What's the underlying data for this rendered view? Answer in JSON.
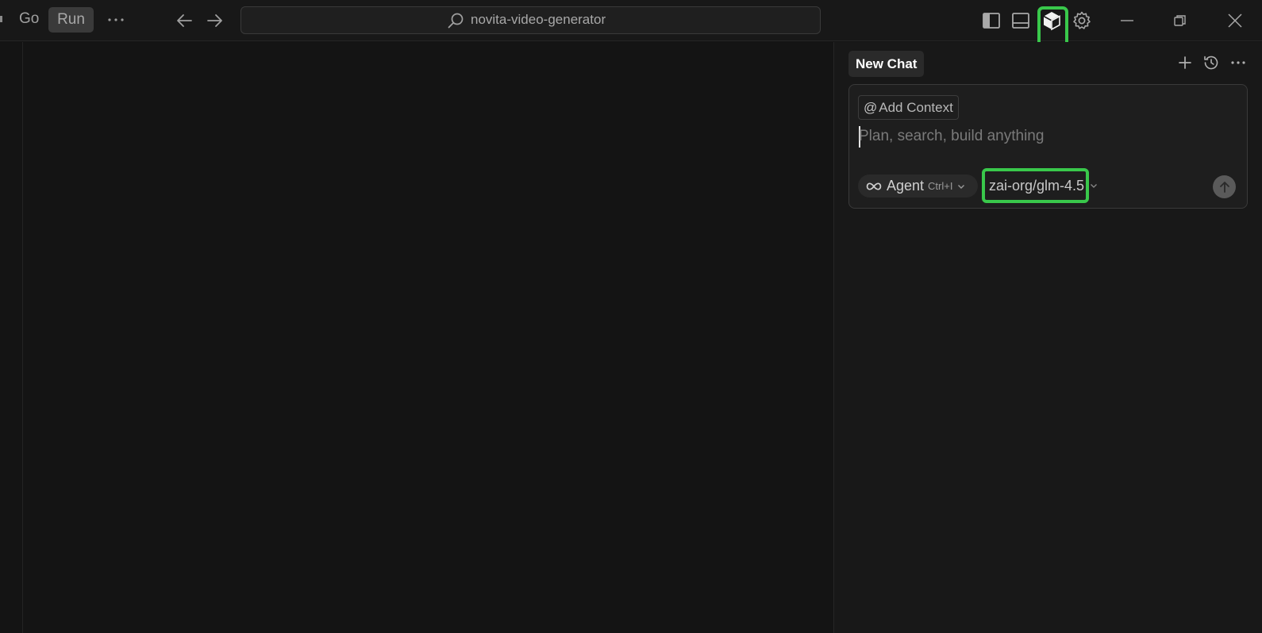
{
  "titlebar": {
    "menu_go": "Go",
    "menu_run": "Run",
    "search_text": "novita-video-generator"
  },
  "icons": {
    "menu_more": "ellipsis-icon",
    "back": "arrow-left-icon",
    "forward": "arrow-right-icon",
    "search": "search-icon",
    "toggle_sidebar": "sidebar-panel-icon",
    "toggle_bottom_panel": "bottom-panel-icon",
    "ai_chat": "cube-icon",
    "settings": "gear-icon",
    "minimize": "minimize-icon",
    "restore": "restore-icon",
    "close": "close-icon"
  },
  "chat": {
    "tab_label": "New Chat",
    "add_context_label": "Add Context",
    "input_placeholder": "Plan, search, build anything",
    "agent_label": "Agent",
    "agent_shortcut": "Ctrl+I",
    "model_name": "zai-org/glm-4.5"
  },
  "colors": {
    "background": "#141414",
    "panel": "#181818",
    "highlight": "#39c84b"
  }
}
